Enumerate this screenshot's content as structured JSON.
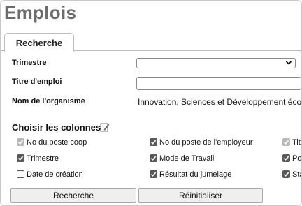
{
  "page_title": "Emplois",
  "tab": {
    "label": "Recherche"
  },
  "form": {
    "trimestre_label": "Trimestre",
    "trimestre_value": "",
    "titre_label": "Titre d'emploi",
    "titre_value": "",
    "org_label": "Nom de l'organisme",
    "org_value": "Innovation, Sciences et Développement écono"
  },
  "columns": {
    "title": "Choisir les colonnes",
    "items": [
      {
        "label": "No du poste coop",
        "state": "disabled-checked"
      },
      {
        "label": "No du poste de l'employeur",
        "state": "checked"
      },
      {
        "label": "Tit",
        "state": "disabled-checked"
      },
      {
        "label": "Trimestre",
        "state": "checked"
      },
      {
        "label": "Mode de Travail",
        "state": "checked"
      },
      {
        "label": "Po",
        "state": "checked"
      },
      {
        "label": "Date de création",
        "state": "unchecked"
      },
      {
        "label": "Résultat du jumelage",
        "state": "checked"
      },
      {
        "label": "Sta",
        "state": "checked"
      }
    ]
  },
  "buttons": {
    "search": "Recherche",
    "reset": "Réinitialiser"
  },
  "colors": {
    "title": "#6b6b6b",
    "checkbox_checked": "#5a5a5a",
    "checkbox_disabled": "#b9b9b9"
  },
  "icons": {
    "edit": "edit-icon",
    "select": "chevron-down-icon"
  }
}
